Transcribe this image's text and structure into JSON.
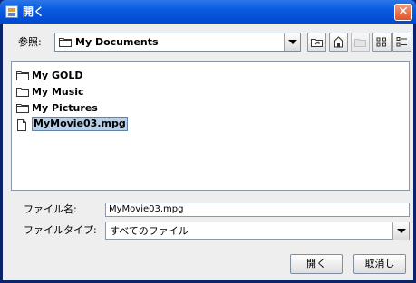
{
  "window": {
    "title": "開く",
    "icon": "java-cup-icon",
    "close_glyph": "✕"
  },
  "lookin": {
    "label": "参照:",
    "value": "My Documents",
    "icon": "folder-icon"
  },
  "toolbar": {
    "buttons": [
      {
        "name": "up-folder-button",
        "icon": "up-folder-icon"
      },
      {
        "name": "home-button",
        "icon": "home-icon"
      },
      {
        "name": "new-folder-button",
        "icon": "new-folder-icon",
        "disabled": true
      },
      {
        "name": "list-view-button",
        "icon": "list-view-icon"
      },
      {
        "name": "details-view-button",
        "icon": "details-view-icon"
      }
    ]
  },
  "files": [
    {
      "label": "My GOLD",
      "type": "folder",
      "selected": false
    },
    {
      "label": "My Music",
      "type": "folder",
      "selected": false
    },
    {
      "label": "My Pictures",
      "type": "folder",
      "selected": false
    },
    {
      "label": "MyMovie03.mpg",
      "type": "file",
      "selected": true
    }
  ],
  "filename": {
    "label": "ファイル名:",
    "value": "MyMovie03.mpg"
  },
  "filetype": {
    "label": "ファイルタイプ:",
    "value": "すべてのファイル"
  },
  "buttons": {
    "open": "開く",
    "cancel": "取消し"
  },
  "colors": {
    "title_bar": "#0a5ce0",
    "selection": "#b8cfe5",
    "close_button": "#e0542a"
  }
}
